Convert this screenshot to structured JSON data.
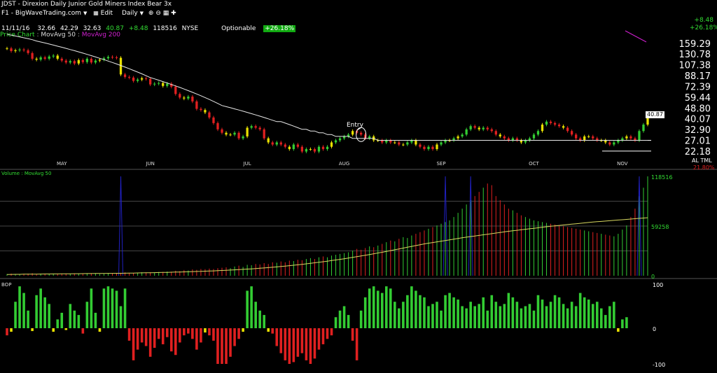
{
  "header": {
    "symbol": "JDST",
    "title": "Direxion Daily Junior Gold Miners Index Bear 3x",
    "tab": "F1 - BigWaveTrading.com",
    "edit": "Edit",
    "interval": "Daily",
    "date": "11/11/16",
    "open": "32.66",
    "high": "42.29",
    "low": "32.63",
    "last": "40.87",
    "change": "+8.48",
    "volume": "118516",
    "exchange": "NYSE",
    "optionable": "Optionable",
    "pct_change": "+26.18%",
    "right_change": "+8.48",
    "right_pct": "+26.18%"
  },
  "price_panel": {
    "legend_chart": "Price Chart",
    "legend_ma50": "MovAvg 50",
    "legend_ma200": "MovAvg 200",
    "annotation": "Entry",
    "last_price_label": "40.87",
    "bottom_right_flags": "AL TML",
    "bottom_right_pct": "21.80%"
  },
  "volume_panel": {
    "legend": "Volume : MovAvg 50",
    "ticks": [
      "118516",
      "59258",
      "0"
    ]
  },
  "bop_panel": {
    "legend": "BOP",
    "ticks": [
      "100",
      "0",
      "-100"
    ]
  },
  "colors": {
    "up": "#33cc33",
    "down": "#e02020",
    "neutral": "#e8e000",
    "ma50": "#e8e8e8",
    "ma200": "#d020d0",
    "vol_ma": "#d8d860",
    "spike": "#2020c0",
    "pct_bg": "#11aa11"
  },
  "chart_data": [
    {
      "type": "candlestick",
      "title": "JDST - Direxion Daily Junior Gold Miners Index Bear 3x",
      "yscale": "log",
      "ylim": [
        19,
        190
      ],
      "y_ticks": [
        159.29,
        130.78,
        107.38,
        88.17,
        72.39,
        59.44,
        48.8,
        40.07,
        32.9,
        27.01,
        22.18
      ],
      "x_month_labels": [
        "MAY",
        "JUN",
        "JUL",
        "AUG",
        "SEP",
        "OCT",
        "NOV"
      ],
      "x_month_index": [
        13,
        34,
        57,
        80,
        103,
        125,
        146
      ],
      "horizontal_lines": [
        27.01,
        22.18
      ],
      "close": [
        145,
        138,
        140,
        142,
        140,
        133,
        120,
        118,
        123,
        120,
        125,
        127,
        120,
        116,
        112,
        115,
        110,
        117,
        113,
        120,
        112,
        116,
        118,
        121,
        124,
        123,
        122,
        90,
        86,
        85,
        80,
        82,
        84,
        83,
        75,
        76,
        77,
        73,
        76,
        72,
        63,
        59,
        58,
        60,
        55,
        48,
        47,
        45,
        41,
        37,
        33,
        31,
        30,
        30,
        31,
        28,
        29,
        34,
        35,
        34,
        33,
        28,
        26,
        25,
        26,
        25,
        24,
        23,
        25,
        24,
        22,
        23,
        23,
        22,
        24,
        23,
        24,
        26,
        27,
        28,
        29,
        30,
        32,
        31,
        30,
        28,
        29,
        27,
        27,
        26,
        27,
        26,
        26,
        25,
        25,
        26,
        27,
        25,
        24,
        23,
        24,
        23,
        25,
        26,
        27,
        27,
        28,
        29,
        30,
        33,
        35,
        34,
        33,
        34,
        33,
        32,
        30,
        29,
        28,
        27,
        28,
        27,
        26,
        27,
        28,
        30,
        32,
        36,
        38,
        37,
        36,
        35,
        34,
        32,
        30,
        28,
        27,
        29,
        29,
        28,
        27,
        27,
        26,
        25,
        26,
        27,
        28,
        29,
        28,
        27,
        32,
        36,
        41
      ],
      "ma50": [
        188,
        185,
        182,
        179,
        176,
        173,
        170,
        166,
        163,
        160,
        157,
        154,
        151,
        148,
        145,
        142,
        139,
        136,
        133,
        130,
        127,
        124,
        121,
        118,
        115,
        112,
        109,
        106,
        103,
        100,
        97,
        94,
        91,
        88,
        85,
        83,
        81,
        79,
        77,
        75,
        73,
        71,
        69,
        67,
        65,
        63,
        61,
        59,
        57,
        55,
        53,
        51,
        50,
        49,
        48,
        47,
        46,
        45,
        44,
        43,
        42,
        41,
        40,
        39,
        38,
        38,
        37,
        36,
        35,
        34,
        33,
        33,
        32,
        32,
        31,
        31,
        30,
        30,
        29,
        29,
        29,
        29,
        28,
        28,
        28,
        28,
        28,
        28,
        27,
        27,
        27,
        27,
        27,
        27,
        27,
        27,
        27,
        27,
        27,
        27,
        27,
        27,
        27,
        27,
        27,
        27,
        27,
        27,
        27,
        27,
        27,
        27,
        27,
        27,
        27,
        27,
        27,
        27,
        27,
        27,
        27,
        27,
        27,
        27,
        27,
        27,
        27,
        27,
        27,
        27,
        27,
        27,
        27,
        27,
        27,
        27,
        27,
        27,
        27,
        27,
        27,
        27,
        27,
        27,
        27,
        27,
        27,
        27,
        27,
        27,
        27,
        27,
        27
      ]
    },
    {
      "type": "bar",
      "title": "Volume : MovAvg 50",
      "ylim": [
        0,
        118516
      ],
      "values": [
        2000,
        2500,
        2000,
        1800,
        2200,
        2500,
        3000,
        2000,
        2500,
        2000,
        2200,
        2500,
        2000,
        2300,
        2400,
        2000,
        2600,
        2200,
        2000,
        2500,
        3000,
        2500,
        2000,
        2200,
        2500,
        3000,
        2800,
        3500,
        4000,
        3000,
        3200,
        3600,
        4200,
        3800,
        4100,
        3800,
        4400,
        4600,
        5000,
        4800,
        6000,
        5500,
        6800,
        6200,
        7500,
        7000,
        8000,
        7800,
        8500,
        8000,
        9000,
        9500,
        10000,
        9000,
        11000,
        12000,
        10500,
        13000,
        12500,
        14000,
        13500,
        15000,
        14000,
        16000,
        15500,
        17000,
        16000,
        18000,
        17500,
        19000,
        18500,
        20000,
        21000,
        20000,
        22000,
        23000,
        22000,
        24000,
        25000,
        26000,
        27000,
        28000,
        30000,
        32000,
        31000,
        33000,
        35000,
        34000,
        36000,
        38000,
        40000,
        42000,
        41000,
        44000,
        46000,
        45000,
        48000,
        50000,
        52000,
        54000,
        56000,
        58000,
        60000,
        62000,
        64000,
        66000,
        70000,
        75000,
        80000,
        85000,
        90000,
        95000,
        100000,
        105000,
        110000,
        108000,
        95000,
        90000,
        85000,
        80000,
        78000,
        75000,
        72000,
        70000,
        68000,
        66000,
        65000,
        64000,
        63000,
        62000,
        61000,
        60000,
        59000,
        58000,
        57000,
        56000,
        55000,
        54000,
        53000,
        52000,
        51000,
        50000,
        49000,
        48000,
        47000,
        50000,
        55000,
        60000,
        70000,
        80000,
        95000,
        105000,
        118516
      ],
      "ma50": [
        1500,
        1600,
        1650,
        1700,
        1800,
        1850,
        1900,
        1950,
        2000,
        2050,
        2100,
        2150,
        2200,
        2250,
        2300,
        2350,
        2400,
        2450,
        2500,
        2550,
        2600,
        2650,
        2700,
        2750,
        2800,
        2850,
        2900,
        2950,
        3000,
        3100,
        3200,
        3300,
        3400,
        3500,
        3600,
        3700,
        3800,
        3900,
        4000,
        4150,
        4300,
        4450,
        4600,
        4750,
        4900,
        5050,
        5200,
        5400,
        5600,
        5800,
        6000,
        6250,
        6500,
        6750,
        7000,
        7300,
        7600,
        7900,
        8200,
        8500,
        8900,
        9300,
        9700,
        10100,
        10500,
        11000,
        11500,
        12000,
        12500,
        13000,
        13600,
        14200,
        14800,
        15400,
        16000,
        16700,
        17400,
        18100,
        18800,
        19500,
        20300,
        21100,
        21900,
        22700,
        23500,
        24400,
        25300,
        26200,
        27100,
        28000,
        29000,
        30000,
        31000,
        32000,
        33000,
        34000,
        35000,
        36000,
        37000,
        38000,
        38800,
        39600,
        40400,
        41200,
        42000,
        42800,
        43600,
        44400,
        45200,
        46000,
        46700,
        47400,
        48100,
        48800,
        49500,
        50200,
        50900,
        51600,
        52300,
        53000,
        53600,
        54200,
        54800,
        55400,
        56000,
        56600,
        57200,
        57800,
        58400,
        59000,
        59500,
        60000,
        60500,
        61000,
        61500,
        62000,
        62500,
        63000,
        63500,
        64000,
        64400,
        64800,
        65200,
        65600,
        66000,
        66400,
        66800,
        67200,
        67600,
        68000,
        68400,
        68800,
        69200
      ]
    },
    {
      "type": "bar",
      "title": "BOP",
      "ylim": [
        -100,
        100
      ],
      "values": [
        -20,
        -10,
        60,
        95,
        80,
        40,
        -8,
        75,
        90,
        70,
        55,
        -10,
        20,
        35,
        -5,
        55,
        40,
        30,
        -15,
        60,
        90,
        35,
        -10,
        90,
        95,
        90,
        85,
        50,
        90,
        -35,
        -90,
        -60,
        -40,
        -50,
        -80,
        -55,
        -30,
        -45,
        -25,
        -65,
        -75,
        -40,
        -20,
        -15,
        -30,
        -60,
        -40,
        -12,
        -20,
        -35,
        -100,
        -100,
        -100,
        -80,
        -50,
        -30,
        -10,
        85,
        95,
        60,
        40,
        30,
        -10,
        -15,
        -50,
        -70,
        -90,
        -100,
        -95,
        -80,
        -70,
        -90,
        -100,
        -85,
        -60,
        -45,
        -30,
        -20,
        25,
        40,
        50,
        30,
        -35,
        -90,
        40,
        70,
        90,
        95,
        85,
        80,
        95,
        90,
        60,
        45,
        60,
        75,
        95,
        85,
        75,
        70,
        50,
        55,
        60,
        40,
        75,
        80,
        70,
        65,
        50,
        45,
        60,
        50,
        55,
        70,
        40,
        75,
        60,
        50,
        55,
        80,
        70,
        60,
        45,
        50,
        55,
        40,
        75,
        65,
        50,
        60,
        75,
        70,
        55,
        45,
        60,
        50,
        80,
        70,
        65,
        55,
        60,
        45,
        30,
        50,
        60,
        -10,
        20,
        25
      ]
    }
  ]
}
